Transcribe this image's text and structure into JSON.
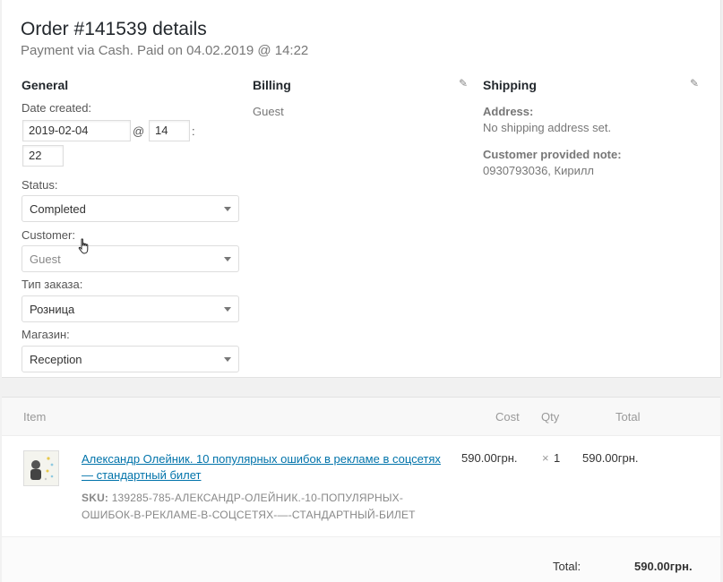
{
  "order": {
    "title": "Order #141539 details",
    "subtitle": "Payment via Cash. Paid on 04.02.2019 @ 14:22"
  },
  "general": {
    "heading": "General",
    "date_label": "Date created:",
    "date_value": "2019-02-04",
    "at": "@",
    "hour_value": "14",
    "colon": ":",
    "minute_value": "22",
    "status_label": "Status:",
    "status_value": "Completed",
    "customer_label": "Customer:",
    "customer_value": "Guest",
    "order_type_label": "Тип заказа:",
    "order_type_value": "Розница",
    "store_label": "Магазин:",
    "store_value": "Reception"
  },
  "billing": {
    "heading": "Billing",
    "text": "Guest"
  },
  "shipping": {
    "heading": "Shipping",
    "address_label": "Address:",
    "address_value": "No shipping address set.",
    "note_label": "Customer provided note:",
    "note_value": "0930793036, Кирилл"
  },
  "items": {
    "headers": {
      "item": "Item",
      "cost": "Cost",
      "qty": "Qty",
      "total": "Total"
    },
    "rows": [
      {
        "name": "Александр Олейник. 10 популярных ошибок в рекламе в соцсетях — стандартный билет",
        "sku_label": "SKU:",
        "sku_value": "139285-785-АЛЕКСАНДР-ОЛЕЙНИК.-10-ПОПУЛЯРНЫХ-ОШИБОК-В-РЕКЛАМЕ-В-СОЦСЕТЯХ-—-СТАНДАРТНЫЙ-БИЛЕТ",
        "cost": "590.00грн.",
        "qty_sign": "×",
        "qty": "1",
        "total": "590.00грн."
      }
    ],
    "total_label": "Total:",
    "total_value": "590.00грн."
  },
  "icons": {
    "edit_billing": "pencil-icon",
    "edit_shipping": "pencil-icon",
    "cursor": "hand-pointer-icon"
  },
  "colors": {
    "link": "#0073aa",
    "heading": "#23282d"
  }
}
